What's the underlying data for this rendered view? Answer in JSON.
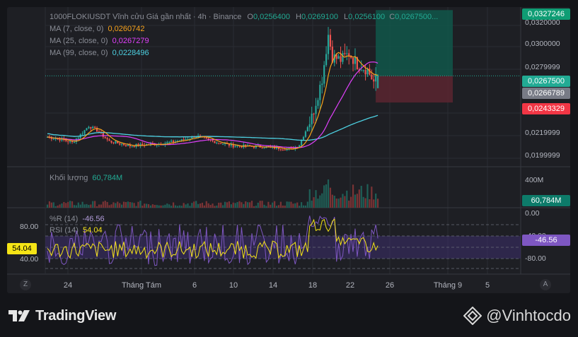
{
  "header": {
    "symbol": "1000FLOKIUSDT Vĩnh cửu Giá gần nhất · 4h · Binance",
    "o_label": "O",
    "o_value": "0,0256400",
    "h_label": "H",
    "h_value": "0,0269100",
    "l_label": "L",
    "l_value": "0,0256100",
    "c_label": "C",
    "c_value": "0,0267500..."
  },
  "ma": [
    {
      "label": "MA (7, close, 0)",
      "value": "0,0260742",
      "color": "#f7a21b"
    },
    {
      "label": "MA (25, close, 0)",
      "value": "0,0267279",
      "color": "#e040fb"
    },
    {
      "label": "MA (99, close, 0)",
      "value": "0,0228496",
      "color": "#4dd0e1"
    }
  ],
  "volume": {
    "label": "Khối lượng",
    "value": "60,784M",
    "scale_tick": "400M",
    "tag": "60,784M"
  },
  "wr": {
    "label": "%R (14)",
    "value": "-46.56",
    "tag": "-46.56",
    "ticks": [
      "0.00",
      "-40.00",
      "-80.00"
    ]
  },
  "rsi": {
    "label": "RSI (14)",
    "value": "54.04",
    "tag": "54.04",
    "ticks": [
      "80.00",
      "40.00"
    ]
  },
  "price_axis": {
    "ticks": [
      "0,0320000",
      "0,0300000",
      "0,0279999",
      "0,0219999",
      "0,0199999"
    ],
    "tags": [
      {
        "text": "0,0327246",
        "color": "#0f9d74"
      },
      {
        "text": "0,0267500",
        "color": "#22ab94"
      },
      {
        "text": "0,0266789",
        "color": "#787b86"
      },
      {
        "text": "0,0243329",
        "color": "#f23645"
      }
    ]
  },
  "time_axis": [
    "24",
    "Tháng Tám",
    "6",
    "10",
    "14",
    "18",
    "22",
    "26",
    "Tháng 9",
    "5"
  ],
  "corner_left": "Z",
  "corner_right": "A",
  "branding": {
    "tradingview": "TradingView",
    "watermark": "@Vinhtocdo"
  },
  "colors": {
    "up": "#26a69a",
    "down": "#ef5350",
    "ma7": "#f7a21b",
    "ma25": "#e040fb",
    "ma99": "#4dd0e1",
    "rsi": "#f5e416",
    "wr": "#7e57c2"
  },
  "chart_data": {
    "type": "candlestick",
    "title": "1000FLOKIUSDT Vĩnh cửu Giá gần nhất · 4h · Binance",
    "xlabel": "",
    "ylabel": "",
    "x_ticks": [
      "24",
      "Tháng Tám",
      "6",
      "10",
      "14",
      "18",
      "22",
      "26",
      "Tháng 9",
      "5"
    ],
    "ylim": [
      0.0185,
      0.033
    ],
    "grid": true,
    "last": {
      "open": 0.02564,
      "high": 0.02691,
      "low": 0.02561,
      "close": 0.02675
    },
    "close_path_anchors": [
      [
        0,
        0.0212
      ],
      [
        6,
        0.021
      ],
      [
        12,
        0.0207
      ],
      [
        15,
        0.0212
      ],
      [
        20,
        0.0222
      ],
      [
        24,
        0.0218
      ],
      [
        30,
        0.0208
      ],
      [
        40,
        0.0204
      ],
      [
        55,
        0.0206
      ],
      [
        65,
        0.0209
      ],
      [
        72,
        0.0213
      ],
      [
        78,
        0.0209
      ],
      [
        90,
        0.0204
      ],
      [
        105,
        0.0203
      ],
      [
        118,
        0.0201
      ],
      [
        122,
        0.0205
      ],
      [
        128,
        0.023
      ],
      [
        133,
        0.0265
      ],
      [
        136,
        0.0305
      ],
      [
        138,
        0.0285
      ],
      [
        142,
        0.0282
      ],
      [
        146,
        0.0288
      ],
      [
        150,
        0.0278
      ],
      [
        155,
        0.0273
      ],
      [
        158,
        0.0262
      ],
      [
        160,
        0.02675
      ]
    ],
    "ma7_last": 0.0260742,
    "ma25_last": 0.0267279,
    "ma99_last": 0.0228496,
    "position": {
      "target": 0.0327246,
      "entry": 0.02675,
      "stop": 0.0243329
    },
    "indicators": {
      "volume_last": "60,784M",
      "rsi14_last": 54.04,
      "wr14_last": -46.56
    }
  }
}
